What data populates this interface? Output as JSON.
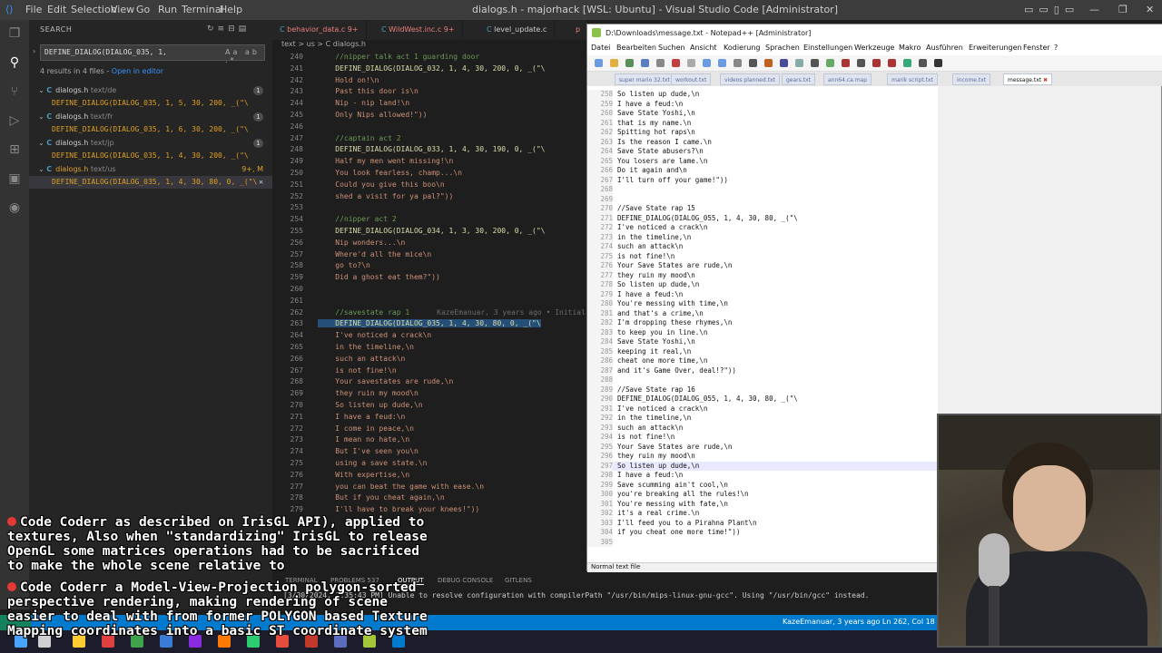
{
  "vscode": {
    "window_title": "dialogs.h - majorhack [WSL: Ubuntu] - Visual Studio Code [Administrator]",
    "menu": [
      "File",
      "Edit",
      "Selection",
      "View",
      "Go",
      "Run",
      "Terminal",
      "Help"
    ],
    "sidebar": {
      "header": "SEARCH",
      "query": "DEFINE_DIALOG(DIALOG_035, 1,",
      "results_info": "4 results in 4 files - ",
      "open_in_editor": "Open in editor",
      "files": [
        {
          "name": "dialogs.h",
          "path": "text/de",
          "count": "1",
          "match": "DEFINE_DIALOG(DIALOG_035, 1, 5, 30, 200, _(\"\\"
        },
        {
          "name": "dialogs.h",
          "path": "text/fr",
          "count": "1",
          "match": "DEFINE_DIALOG(DIALOG_035, 1, 6, 30, 200, _(\"\\"
        },
        {
          "name": "dialogs.h",
          "path": "text/jp",
          "count": "1",
          "match": "DEFINE_DIALOG(DIALOG_035, 1, 4, 30, 200, _(\"\\"
        },
        {
          "name": "dialogs.h",
          "path": "text/us",
          "count": "9+, M",
          "match": "DEFINE_DIALOG(DIALOG_035, 1, 4, 30, 80, 0, _(\"\\"
        }
      ]
    },
    "tabs": [
      {
        "label": "behavior_data.c 9+"
      },
      {
        "label": "WildWest.inc.c 9+"
      },
      {
        "label": "level_update.c"
      },
      {
        "label": "p"
      }
    ],
    "breadcrumb": "text > us > C dialogs.h",
    "code_lines": [
      {
        "n": "240",
        "t": "    //nipper talk act 1 guarding door",
        "k": "cm"
      },
      {
        "n": "241",
        "t": "    DEFINE_DIALOG(DIALOG_032, 1, 4, 30, 200, 0, _(\"\\",
        "k": "def"
      },
      {
        "n": "242",
        "t": "    Hold on!\\n",
        "k": ""
      },
      {
        "n": "243",
        "t": "    Past this door is\\n",
        "k": ""
      },
      {
        "n": "244",
        "t": "    Nip - nip land!\\n",
        "k": ""
      },
      {
        "n": "245",
        "t": "    Only Nips allowed!\"))",
        "k": ""
      },
      {
        "n": "246",
        "t": "",
        "k": ""
      },
      {
        "n": "247",
        "t": "    //captain act 2",
        "k": "cm"
      },
      {
        "n": "248",
        "t": "    DEFINE_DIALOG(DIALOG_033, 1, 4, 30, 190, 0, _(\"\\",
        "k": "def"
      },
      {
        "n": "249",
        "t": "    Half my men went missing!\\n",
        "k": ""
      },
      {
        "n": "250",
        "t": "    You look fearless, champ...\\n",
        "k": ""
      },
      {
        "n": "251",
        "t": "    Could you give this boo\\n",
        "k": ""
      },
      {
        "n": "252",
        "t": "    shed a visit for ya pal?\"))",
        "k": ""
      },
      {
        "n": "253",
        "t": "",
        "k": ""
      },
      {
        "n": "254",
        "t": "    //nipper act 2",
        "k": "cm"
      },
      {
        "n": "255",
        "t": "    DEFINE_DIALOG(DIALOG_034, 1, 3, 30, 200, 0, _(\"\\",
        "k": "def"
      },
      {
        "n": "256",
        "t": "    Nip wonders...\\n",
        "k": ""
      },
      {
        "n": "257",
        "t": "    Where'd all the mice\\n",
        "k": ""
      },
      {
        "n": "258",
        "t": "    go to?\\n",
        "k": ""
      },
      {
        "n": "259",
        "t": "    Did a ghost eat them?\"))",
        "k": ""
      },
      {
        "n": "260",
        "t": "",
        "k": ""
      },
      {
        "n": "261",
        "t": "",
        "k": ""
      },
      {
        "n": "262",
        "t": "    //savestate rap 1",
        "k": "cm",
        "blame": "KazeEmanuar, 3 years ago • Initial"
      },
      {
        "n": "263",
        "t": "    DEFINE_DIALOG(DIALOG_035, 1, 4, 30, 80, 0, _(\"\\",
        "k": "def sel"
      },
      {
        "n": "264",
        "t": "    I've noticed a crack\\n",
        "k": ""
      },
      {
        "n": "265",
        "t": "    in the timeline,\\n",
        "k": ""
      },
      {
        "n": "266",
        "t": "    such an attack\\n",
        "k": ""
      },
      {
        "n": "267",
        "t": "    is not fine!\\n",
        "k": ""
      },
      {
        "n": "268",
        "t": "    Your savestates are rude,\\n",
        "k": ""
      },
      {
        "n": "269",
        "t": "    they ruin my mood\\n",
        "k": ""
      },
      {
        "n": "270",
        "t": "    So listen up dude,\\n",
        "k": ""
      },
      {
        "n": "271",
        "t": "    I have a feud:\\n",
        "k": ""
      },
      {
        "n": "272",
        "t": "    I come in peace,\\n",
        "k": ""
      },
      {
        "n": "273",
        "t": "    I mean no hate,\\n",
        "k": ""
      },
      {
        "n": "274",
        "t": "    But I've seen you\\n",
        "k": ""
      },
      {
        "n": "275",
        "t": "    using a save state.\\n",
        "k": ""
      },
      {
        "n": "276",
        "t": "    With expertise,\\n",
        "k": ""
      },
      {
        "n": "277",
        "t": "    you can beat the game with ease.\\n",
        "k": ""
      },
      {
        "n": "278",
        "t": "    But if you cheat again,\\n",
        "k": ""
      },
      {
        "n": "279",
        "t": "    I'll have to break your knees!\"))",
        "k": ""
      }
    ],
    "panel_tabs": [
      "TERMINAL",
      "PROBLEMS 537",
      "OUTPUT",
      "DEBUG CONSOLE",
      "GITLENS"
    ],
    "output_line": "[3/30/2024, 2:35:43 PM] Unable to resolve configuration with compilerPath \"/usr/bin/mips-linux-gnu-gcc\".  Using \"/usr/bin/gcc\" instead.",
    "status_right": "KazeEmanuar, 3 years ago    Ln 262, Col 18 (5"
  },
  "npp": {
    "title": "D:\\Downloads\\message.txt - Notepad++ [Administrator]",
    "menu": [
      "Datei",
      "Bearbeiten",
      "Suchen",
      "Ansicht",
      "Kodierung",
      "Sprachen",
      "Einstellungen",
      "Werkzeuge",
      "Makro",
      "Ausführen",
      "Erweiterungen",
      "Fenster",
      "?"
    ],
    "tabs": [
      "super mario 32.txt",
      "workout.txt",
      "videos planned.txt",
      "gears.txt",
      "ann64.ca.map",
      "marik script.txt",
      "income.txt",
      "message.txt"
    ],
    "status": "Normal text file",
    "lines": [
      {
        "n": "258",
        "t": "So listen up dude,\\n"
      },
      {
        "n": "259",
        "t": "I have a feud:\\n"
      },
      {
        "n": "260",
        "t": "Save State Yoshi,\\n"
      },
      {
        "n": "261",
        "t": "that is my name.\\n"
      },
      {
        "n": "262",
        "t": "Spitting hot raps\\n"
      },
      {
        "n": "263",
        "t": "Is the reason I came.\\n"
      },
      {
        "n": "264",
        "t": "Save State abusers?\\n"
      },
      {
        "n": "265",
        "t": "You losers are lame.\\n"
      },
      {
        "n": "266",
        "t": "Do it again and\\n"
      },
      {
        "n": "267",
        "t": "I'll turn off your game!\"))"
      },
      {
        "n": "268",
        "t": ""
      },
      {
        "n": "269",
        "t": ""
      },
      {
        "n": "270",
        "t": "//Save State rap 15"
      },
      {
        "n": "271",
        "t": "DEFINE_DIALOG(DIALOG_055, 1, 4, 30, 80, _(\"\\"
      },
      {
        "n": "272",
        "t": "I've noticed a crack\\n"
      },
      {
        "n": "273",
        "t": "in the timeline,\\n"
      },
      {
        "n": "274",
        "t": "such an attack\\n"
      },
      {
        "n": "275",
        "t": "is not fine!\\n"
      },
      {
        "n": "276",
        "t": "Your Save States are rude,\\n"
      },
      {
        "n": "277",
        "t": "they ruin my mood\\n"
      },
      {
        "n": "278",
        "t": "So listen up dude,\\n"
      },
      {
        "n": "279",
        "t": "I have a feud:\\n"
      },
      {
        "n": "280",
        "t": "You're messing with time,\\n"
      },
      {
        "n": "281",
        "t": "and that's a crime,\\n"
      },
      {
        "n": "282",
        "t": "I'm dropping these rhymes,\\n"
      },
      {
        "n": "283",
        "t": "to keep you in line.\\n"
      },
      {
        "n": "284",
        "t": "Save State Yoshi,\\n"
      },
      {
        "n": "285",
        "t": "keeping it real,\\n"
      },
      {
        "n": "286",
        "t": "cheat one more time,\\n"
      },
      {
        "n": "287",
        "t": "and it's Game Over, deal!?\"))"
      },
      {
        "n": "288",
        "t": ""
      },
      {
        "n": "289",
        "t": "//Save State rap 16"
      },
      {
        "n": "290",
        "t": "DEFINE_DIALOG(DIALOG_055, 1, 4, 30, 80, _(\"\\"
      },
      {
        "n": "291",
        "t": "I've noticed a crack\\n"
      },
      {
        "n": "292",
        "t": "in the timeline,\\n"
      },
      {
        "n": "293",
        "t": "such an attack\\n"
      },
      {
        "n": "294",
        "t": "is not fine!\\n"
      },
      {
        "n": "295",
        "t": "Your Save States are rude,\\n"
      },
      {
        "n": "296",
        "t": "they ruin my mood\\n"
      },
      {
        "n": "297",
        "t": "So listen up dude,\\n"
      },
      {
        "n": "298",
        "t": "I have a feud:\\n"
      },
      {
        "n": "299",
        "t": "Save scumming ain't cool,\\n"
      },
      {
        "n": "300",
        "t": "you're breaking all the rules!\\n"
      },
      {
        "n": "301",
        "t": "You're messing with fate,\\n"
      },
      {
        "n": "302",
        "t": "it's a real crime.\\n"
      },
      {
        "n": "303",
        "t": "I'll feed you to a Pirahna Plant\\n"
      },
      {
        "n": "304",
        "t": "if you cheat one more time!\"))"
      },
      {
        "n": "305",
        "t": ""
      }
    ]
  },
  "chat": {
    "messages": [
      {
        "user": "Code Coderr",
        "text": " as described on IrisGL API), applied to"
      },
      {
        "user": "",
        "text": "textures, Also when \"standardizing\" IrisGL to release"
      },
      {
        "user": "",
        "text": "OpenGL some matrices operations had to be sacrificed"
      },
      {
        "user": "",
        "text": "to make the whole scene relative to"
      },
      {
        "user": "Code Coderr",
        "text": " a Model-View-Projection polygon-sorted"
      },
      {
        "user": "",
        "text": "perspective rendering, making rendering of scene"
      },
      {
        "user": "",
        "text": "easier to deal with from former POLYGON based Texture"
      },
      {
        "user": "",
        "text": "Mapping coordinates into a basic ST coordinate system"
      }
    ]
  },
  "colors": {
    "vscode_bg": "#1e1e1e",
    "status_blue": "#007acc",
    "match_orange": "#e0a020",
    "chat_dot": "#e53935"
  }
}
